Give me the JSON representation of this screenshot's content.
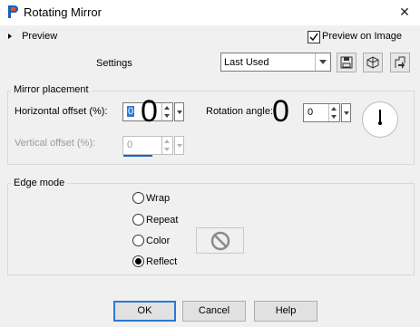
{
  "window": {
    "title": "Rotating Mirror",
    "close_glyph": "✕"
  },
  "preview": {
    "toggle_label": "Preview",
    "checkbox_label": "Preview on Image",
    "checked": true
  },
  "settings": {
    "label": "Settings",
    "preset_value": "Last Used"
  },
  "toolbar_icons": [
    "save-preset-icon",
    "reset-icon",
    "preset-manager-icon"
  ],
  "mirror_placement": {
    "legend": "Mirror placement",
    "horizontal_label": "Horizontal offset (%):",
    "horizontal_display": "0",
    "horizontal_value": "0",
    "rotation_label": "Rotation angle:",
    "rotation_display": "0",
    "rotation_value": "0",
    "vertical_label": "Vertical offset (%):",
    "vertical_value": "0"
  },
  "edge_mode": {
    "legend": "Edge mode",
    "options": [
      "Wrap",
      "Repeat",
      "Color",
      "Reflect"
    ],
    "selected": "Reflect"
  },
  "buttons": {
    "ok": "OK",
    "cancel": "Cancel",
    "help": "Help"
  }
}
